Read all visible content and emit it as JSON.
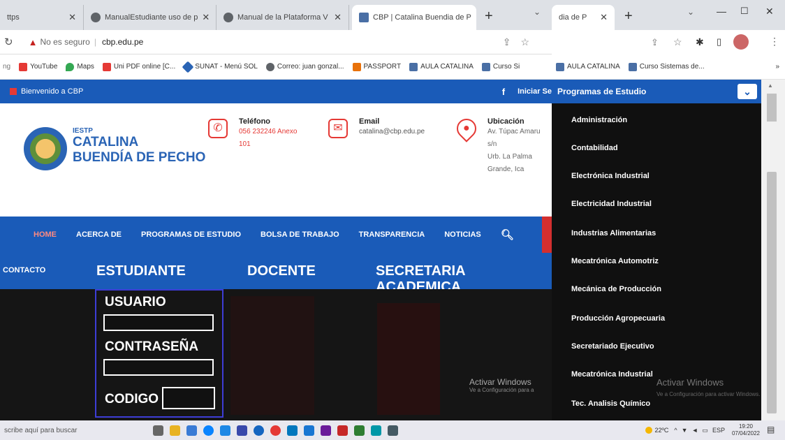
{
  "browser": {
    "tabs": [
      {
        "title": "ttps"
      },
      {
        "title": "ManualEstudiante uso de p"
      },
      {
        "title": "Manual de la Plataforma V"
      },
      {
        "title": "CBP | Catalina Buendia de P"
      }
    ],
    "new_tab": "+",
    "address": {
      "security": "No es seguro",
      "url": "cbp.edu.pe"
    },
    "bookmarks": [
      "YouTube",
      "Maps",
      "Uni PDF online [C...",
      "SUNAT - Menú SOL",
      "Correo: juan gonzal...",
      "PASSPORT",
      "AULA CATALINA",
      "Curso Si"
    ],
    "right_tab": "dia de P",
    "right_bookmarks": [
      "AULA CATALINA",
      "Curso Sistemas de..."
    ]
  },
  "page": {
    "welcome": "Bienvenido a CBP",
    "facebook": "f",
    "login_link": "Iniciar Se",
    "logo": {
      "small": "IESTP",
      "line1": "CATALINA",
      "line2": "BUENDÍA DE PECHO"
    },
    "phone": {
      "title": "Teléfono",
      "line1": "056 232246 Anexo",
      "line2": "101"
    },
    "email": {
      "title": "Email",
      "value": "catalina@cbp.edu.pe"
    },
    "location": {
      "title": "Ubicación",
      "line1": "Av. Túpac Amaru",
      "line2": "s/n",
      "line3": "Urb. La Palma",
      "line4": "Grande, Ica"
    },
    "nav": [
      "HOME",
      "ACERCA DE",
      "PROGRAMAS DE ESTUDIO",
      "BOLSA DE TRABAJO",
      "TRANSPARENCIA",
      "NOTICIAS"
    ],
    "subnav": {
      "contact": "CONTACTO",
      "student": "ESTUDIANTE",
      "teacher": "DOCENTE",
      "secretary": "SECRETARIA ACADEMICA"
    },
    "login_form": {
      "user_label": "USUARIO",
      "password_label": "CONTRASEÑA",
      "code_label": "CODIGO"
    },
    "watermark": {
      "title": "Activar Windows",
      "sub": "Ve a Configuración para a"
    }
  },
  "dropdown": {
    "header": "Programas de Estudio",
    "items": [
      "Administración",
      "Contabilidad",
      "Electrónica Industrial",
      "Electricidad Industrial",
      "Industrias Alimentarias",
      "Mecatrónica Automotriz",
      "Mecánica de Producción",
      "Producción Agropecuaria",
      "Secretariado Ejecutivo",
      "Mecatrónica Industrial",
      "Tec. Analisis Químico"
    ],
    "watermark_title": "Activar Windows",
    "watermark_sub": "Ve a Configuración para activar Windows."
  },
  "taskbar": {
    "search_placeholder": "scribe aquí para buscar",
    "weather": "22ºC",
    "lang": "ESP",
    "time": "19:20",
    "date": "07/04/2022"
  },
  "colors": {
    "primary_blue": "#1a5bb8",
    "accent_red": "#e53935",
    "dark": "#101010"
  }
}
